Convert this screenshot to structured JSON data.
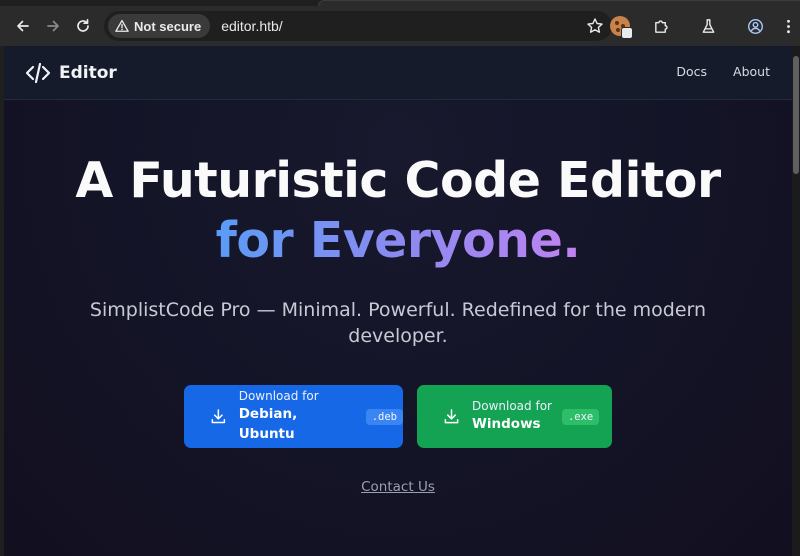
{
  "browser": {
    "security_label": "Not secure",
    "url": "editor.htb/",
    "icons": {
      "back": "arrow-left-icon",
      "forward": "arrow-right-icon",
      "reload": "reload-icon",
      "security": "warning-triangle-icon",
      "bookmark": "star-icon",
      "extension_1": "cookie-icon",
      "extensions": "puzzle-icon",
      "labs": "flask-icon",
      "profile": "profile-icon",
      "menu": "kebab-menu-icon"
    }
  },
  "site": {
    "brand": "Editor",
    "brand_icon": "code-brackets-icon",
    "nav": [
      {
        "label": "Docs"
      },
      {
        "label": "About"
      }
    ]
  },
  "hero": {
    "title_line1": "A Futuristic Code Editor",
    "title_line2": "for Everyone.",
    "subtitle": "SimplistCode Pro — Minimal. Powerful. Redefined for the modern developer."
  },
  "downloads": [
    {
      "small": "Download for",
      "big": "Debian, Ubuntu",
      "ext": ".deb",
      "color": "#1768e6"
    },
    {
      "small": "Download for",
      "big": "Windows",
      "ext": ".exe",
      "color": "#14a352"
    }
  ],
  "contact_label": "Contact Us",
  "colors": {
    "gradient_start": "#5b9cf6",
    "gradient_end": "#c083f0",
    "page_bg": "#141427"
  }
}
